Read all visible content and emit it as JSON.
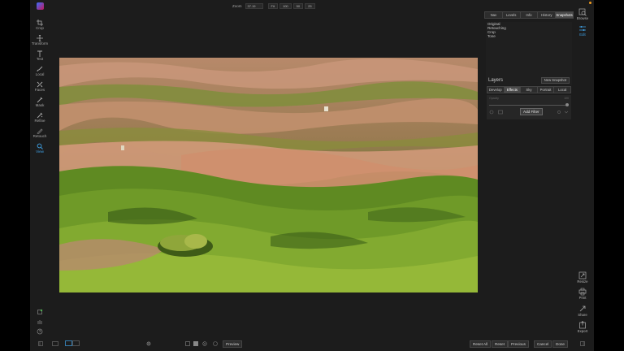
{
  "topbar": {
    "zoom_label": "Zoom",
    "zoom_value": "37.19",
    "fit": "Fit",
    "z100": "100",
    "z50": "50",
    "z25": "25"
  },
  "tools": [
    {
      "label": "Crop",
      "icon": "crop-icon"
    },
    {
      "label": "Transform",
      "icon": "transform-icon"
    },
    {
      "label": "Text",
      "icon": "text-icon"
    },
    {
      "label": "Local",
      "icon": "local-brush-icon"
    },
    {
      "label": "Faces",
      "icon": "faces-icon"
    },
    {
      "label": "Mask",
      "icon": "mask-icon"
    },
    {
      "label": "Refine",
      "icon": "refine-icon"
    },
    {
      "label": "Retouch",
      "icon": "retouch-icon"
    },
    {
      "label": "View",
      "icon": "view-icon"
    }
  ],
  "panel": {
    "tabs": [
      "Nav",
      "Levels",
      "Info",
      "History",
      "Snapshots"
    ],
    "active_tab": "Snapshots",
    "snapshots": [
      "Original",
      "Retouching",
      "Crop",
      "Tone"
    ],
    "new_snapshot": "New Snapshot",
    "layers_title": "Layers",
    "layer_tabs": [
      "Develop",
      "Effects",
      "Sky",
      "Portrait",
      "Local"
    ],
    "active_layer_tab": "Effects",
    "opacity_label": "Opacity",
    "opacity_value": "100",
    "add_filter": "Add Filter"
  },
  "modules": [
    {
      "label": "Browse",
      "icon": "browse-icon"
    },
    {
      "label": "Edit",
      "icon": "edit-sliders-icon"
    },
    {
      "label": "Resize",
      "icon": "resize-icon"
    },
    {
      "label": "Print",
      "icon": "print-icon"
    },
    {
      "label": "Share",
      "icon": "share-icon"
    },
    {
      "label": "Export",
      "icon": "export-icon"
    }
  ],
  "bottombar": {
    "preview": "Preview",
    "reset_all": "Reset All",
    "reset": "Reset",
    "previous": "Previous",
    "cancel": "Cancel",
    "done": "Done"
  },
  "colors": {
    "accent": "#3fa3e8",
    "panel_bg": "#1c1c1c",
    "notification": "#f29c1f"
  }
}
